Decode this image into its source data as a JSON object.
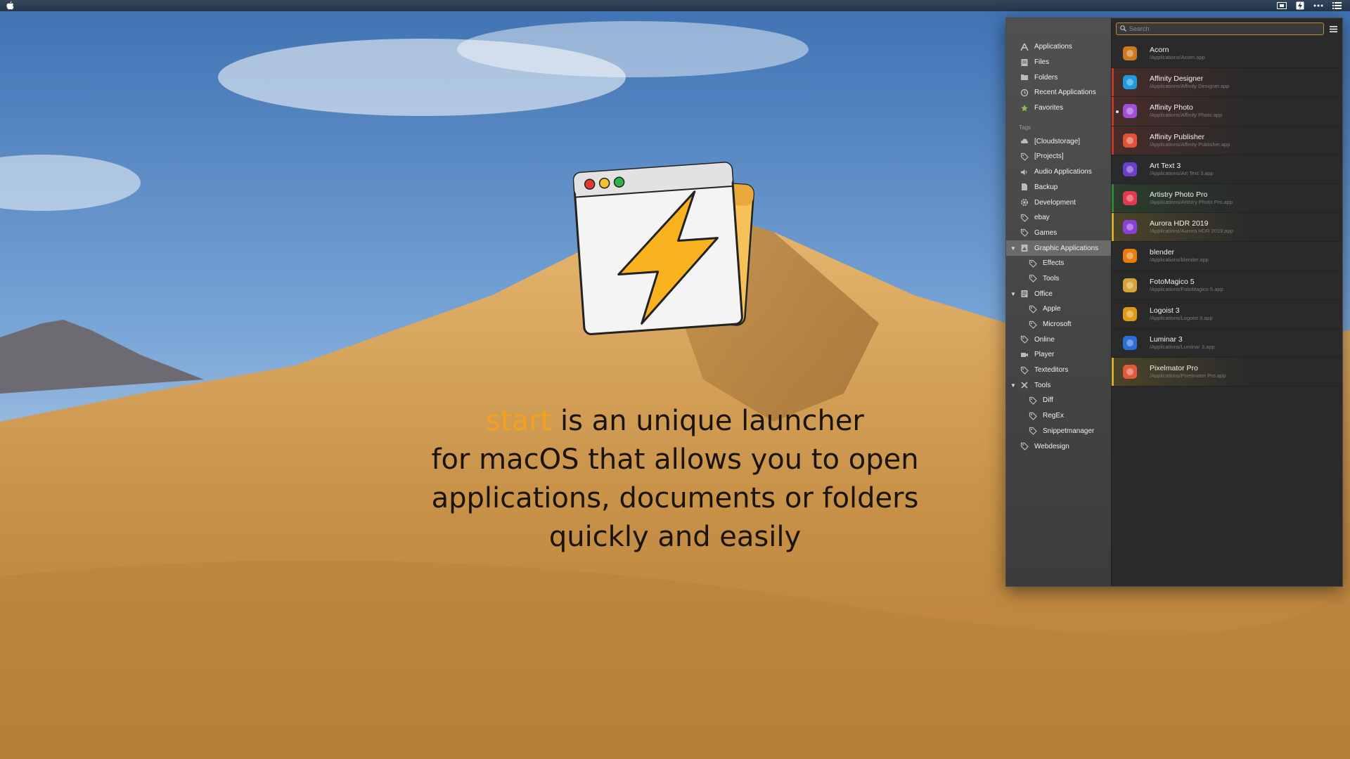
{
  "menubar": {
    "apple_icon": "apple-icon",
    "status_icons": [
      "screen-icon",
      "start-app-icon",
      "more-dots-icon",
      "list-icon"
    ]
  },
  "hero": {
    "brand": "start",
    "line1_rest": " is an unique launcher",
    "line2": "for macOS that allows you to open",
    "line3": "applications, documents or folders",
    "line4": "quickly and easily",
    "brand_color": "#f2a21c"
  },
  "launcher": {
    "search": {
      "placeholder": "Search",
      "value": ""
    },
    "sidebar": {
      "sections": [
        {
          "label": "Applications",
          "icon": "applications-icon"
        },
        {
          "label": "Files",
          "icon": "files-icon"
        },
        {
          "label": "Folders",
          "icon": "folder-icon"
        },
        {
          "label": "Recent Applications",
          "icon": "recent-icon"
        },
        {
          "label": "Favorites",
          "icon": "star-icon"
        }
      ],
      "tags_heading": "Tags",
      "tags": [
        {
          "label": "[Cloudstorage]",
          "icon": "cloud-icon",
          "child": false
        },
        {
          "label": "[Projects]",
          "icon": "tag-icon",
          "child": false
        },
        {
          "label": "Audio Applications",
          "icon": "speaker-icon",
          "child": false
        },
        {
          "label": "Backup",
          "icon": "document-icon",
          "child": false
        },
        {
          "label": "Development",
          "icon": "gear-icon",
          "child": false
        },
        {
          "label": "ebay",
          "icon": "tag-icon",
          "child": false
        },
        {
          "label": "Games",
          "icon": "tag-icon",
          "child": false
        },
        {
          "label": "Graphic Applications",
          "icon": "graphic-icon",
          "child": false,
          "expanded": true,
          "selected": true
        },
        {
          "label": "Effects",
          "icon": "tag-icon",
          "child": true
        },
        {
          "label": "Tools",
          "icon": "tag-icon",
          "child": true
        },
        {
          "label": "Office",
          "icon": "office-icon",
          "child": false,
          "expanded": true
        },
        {
          "label": "Apple",
          "icon": "tag-icon",
          "child": true
        },
        {
          "label": "Microsoft",
          "icon": "tag-icon",
          "child": true
        },
        {
          "label": "Online",
          "icon": "tag-icon",
          "child": false
        },
        {
          "label": "Player",
          "icon": "video-icon",
          "child": false
        },
        {
          "label": "Texteditors",
          "icon": "tag-icon",
          "child": false
        },
        {
          "label": "Tools",
          "icon": "tools-icon",
          "child": false,
          "expanded": true
        },
        {
          "label": "Diff",
          "icon": "tag-icon",
          "child": true
        },
        {
          "label": "RegEx",
          "icon": "tag-icon",
          "child": true
        },
        {
          "label": "Snippetmanager",
          "icon": "tag-icon",
          "child": true
        },
        {
          "label": "Webdesign",
          "icon": "tag-icon",
          "child": false
        }
      ]
    },
    "apps": [
      {
        "name": "Acorn",
        "path": "/Applications/Acorn.app",
        "icon": "acorn-icon",
        "color": "#d07a20",
        "marker": ""
      },
      {
        "name": "Affinity Designer",
        "path": "/Applications/Affinity Designer.app",
        "icon": "affinity-designer-icon",
        "color": "#1e9be0",
        "marker": "#c0392b"
      },
      {
        "name": "Affinity Photo",
        "path": "/Applications/Affinity Photo.app",
        "icon": "affinity-photo-icon",
        "color": "#a24fd6",
        "marker": "#c0392b",
        "running": true
      },
      {
        "name": "Affinity Publisher",
        "path": "/Applications/Affinity Publisher.app",
        "icon": "affinity-publisher-icon",
        "color": "#e0533a",
        "marker": "#c0392b"
      },
      {
        "name": "Art Text 3",
        "path": "/Applications/Art Text 3.app",
        "icon": "art-text-icon",
        "color": "#6b3fc9",
        "marker": ""
      },
      {
        "name": "Artistry Photo Pro",
        "path": "/Applications/Artistry Photo Pro.app",
        "icon": "artistry-icon",
        "color": "#e03a52",
        "marker": "#2f8a3a"
      },
      {
        "name": "Aurora HDR 2019",
        "path": "/Applications/Aurora HDR 2019.app",
        "icon": "aurora-icon",
        "color": "#8a3fd6",
        "marker": "#d4b020"
      },
      {
        "name": "blender",
        "path": "/Applications/blender.app",
        "icon": "blender-icon",
        "color": "#e87d0d",
        "marker": ""
      },
      {
        "name": "FotoMagico 5",
        "path": "/Applications/FotoMagico 5.app",
        "icon": "fotomagico-icon",
        "color": "#d8a23a",
        "marker": ""
      },
      {
        "name": "Logoist 3",
        "path": "/Applications/Logoist 3.app",
        "icon": "logoist-icon",
        "color": "#e09a1a",
        "marker": ""
      },
      {
        "name": "Luminar 3",
        "path": "/Applications/Luminar 3.app",
        "icon": "luminar-icon",
        "color": "#2a6fd6",
        "marker": ""
      },
      {
        "name": "Pixelmator Pro",
        "path": "/Applications/Pixelmator Pro.app",
        "icon": "pixelmator-icon",
        "color": "#e05a3a",
        "marker": "#d4b020"
      }
    ]
  }
}
